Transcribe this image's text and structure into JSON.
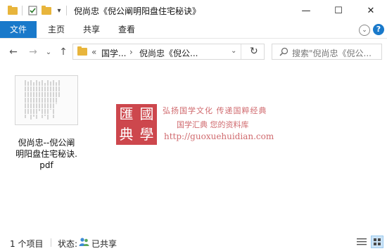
{
  "window": {
    "title": "倪尚忠《倪公阐明阳盘住宅秘诀》",
    "minimize": "—",
    "maximize": "☐",
    "close": "✕"
  },
  "ribbon": {
    "tabs": [
      "文件",
      "主页",
      "共享",
      "查看"
    ]
  },
  "nav": {
    "back": "←",
    "forward": "→",
    "recent": "⌄",
    "up": "↑",
    "breadcrumb_sep_start": "«",
    "crumbs": [
      "国学...",
      "倪尚忠《倪公..."
    ],
    "crumb_arrow": "›",
    "refresh": "↻",
    "search_placeholder": "搜索\"倪尚忠《倪公..."
  },
  "file": {
    "name_lines": [
      "倪尚忠--倪公阐",
      "明阳盘住宅秘诀.",
      "pdf"
    ]
  },
  "watermark": {
    "seal_chars": [
      "匯",
      "國",
      "典",
      "學"
    ],
    "line1": "弘扬国学文化  传递国粹经典",
    "line2": "国学汇典 您的资料库",
    "url": "http://guoxuehuidian.com"
  },
  "status": {
    "count": "1 个项目",
    "state_label": "状态:",
    "state_value": "已共享"
  },
  "colors": {
    "accent": "#1979ca",
    "folder": "#e8b53c",
    "seal_red": "#c8343a"
  }
}
